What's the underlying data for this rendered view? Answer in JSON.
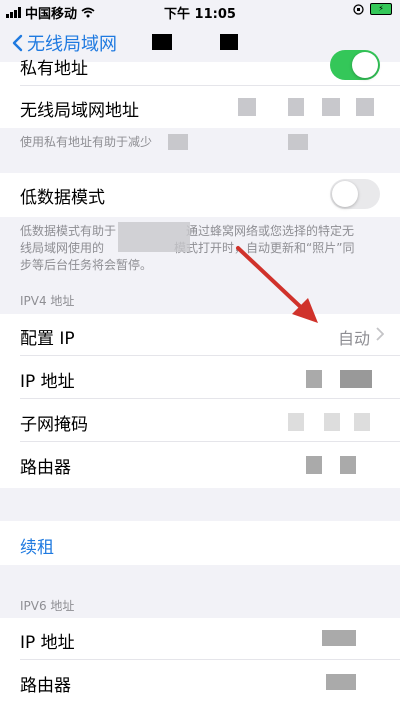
{
  "status": {
    "carrier": "中国移动",
    "time": "下午 11:05"
  },
  "nav": {
    "back_label": "无线局域网"
  },
  "private_address": {
    "label": "私有地址",
    "toggle_on": true
  },
  "wifi_address": {
    "label": "无线局域网地址",
    "note": "使用私有地址有助于减少"
  },
  "low_data": {
    "label": "低数据模式",
    "toggle_on": false,
    "note_line1": "低数据模式有助于",
    "note_line1b": "通过蜂窝网络或您选择的特定无",
    "note_line2": "线局域网使用的",
    "note_line2b": "模式打开时，自动更新和“照片”同",
    "note_line3": "步等后台任务将会暂停。"
  },
  "ipv4": {
    "header": "IPV4 地址",
    "config_ip": {
      "label": "配置 IP",
      "value": "自动"
    },
    "ip": {
      "label": "IP 地址"
    },
    "subnet": {
      "label": "子网掩码"
    },
    "router": {
      "label": "路由器"
    }
  },
  "renew": {
    "label": "续租"
  },
  "ipv6": {
    "header": "IPV6 地址",
    "ip": {
      "label": "IP 地址"
    },
    "router": {
      "label": "路由器"
    }
  },
  "colors": {
    "accent": "#1f7ae0",
    "toggle_on": "#34c759",
    "arrow": "#d0322b"
  }
}
